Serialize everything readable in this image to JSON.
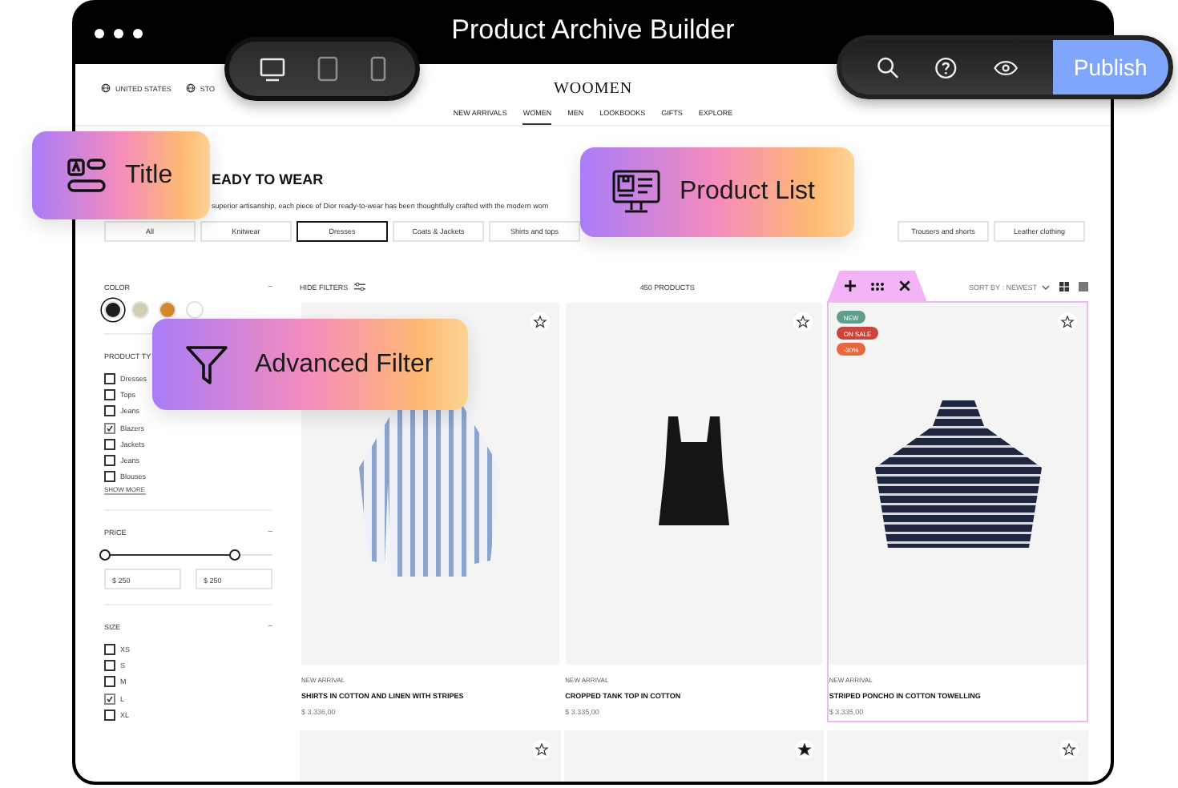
{
  "window": {
    "title": "Product Archive Builder"
  },
  "device_switcher": [
    {
      "kind": "desktop",
      "selected": true
    },
    {
      "kind": "tablet",
      "selected": false
    },
    {
      "kind": "phone",
      "selected": false
    }
  ],
  "toolbar": {
    "publish": "Publish"
  },
  "store": {
    "locale_links": [
      "UNITED STATES",
      "STO"
    ],
    "logo": "WOOMEN",
    "nav": [
      {
        "label": "NEW ARRIVALS",
        "selected": false
      },
      {
        "label": "WOMEN",
        "selected": true
      },
      {
        "label": "MEN",
        "selected": false
      },
      {
        "label": "LOOKBOOKS",
        "selected": false
      },
      {
        "label": "GIFTS",
        "selected": false
      },
      {
        "label": "EXPLORE",
        "selected": false
      }
    ],
    "heading": "EADY TO WEAR",
    "description": "superior artisanship, each piece of Dior ready-to-wear has been thoughtfully crafted with the modern wom",
    "categories": [
      {
        "label": "All",
        "selected": false
      },
      {
        "label": "Knitwear",
        "selected": false
      },
      {
        "label": "Dresses",
        "selected": true
      },
      {
        "label": "Coats & Jackets",
        "selected": false
      },
      {
        "label": "Shirts and tops",
        "selected": false
      },
      {
        "label": "Trousers and shorts",
        "selected": false
      },
      {
        "label": "Leather clothing",
        "selected": false
      }
    ]
  },
  "filters": {
    "color": {
      "title": "COLOR",
      "toggle": "–",
      "swatches": [
        {
          "color": "#1c1c1c",
          "selected": true
        },
        {
          "color": "#d3ceb2",
          "selected": false
        },
        {
          "color": "#d48a2c",
          "selected": false
        },
        {
          "color": "#ffffff",
          "selected": false
        }
      ]
    },
    "product_type": {
      "title": "PRODUCT TY",
      "options": [
        {
          "label": "Dresses",
          "checked": false
        },
        {
          "label": "Tops",
          "checked": false
        },
        {
          "label": "Jeans",
          "checked": false
        },
        {
          "label": "Blazers",
          "checked": true
        },
        {
          "label": "Jackets",
          "checked": false
        },
        {
          "label": "Jeans",
          "checked": false
        },
        {
          "label": "Blouses",
          "checked": false
        }
      ],
      "show_more": "SHOW MORE"
    },
    "price": {
      "title": "PRICE",
      "toggle": "–",
      "range_start": {
        "level": 0
      },
      "range_end": {
        "level": 0.77
      },
      "min": "$ 250",
      "max": "$ 250"
    },
    "size": {
      "title": "SIZE",
      "toggle": "–",
      "options": [
        {
          "label": "XS",
          "checked": false
        },
        {
          "label": "S",
          "checked": false
        },
        {
          "label": "M",
          "checked": false
        },
        {
          "label": "L",
          "checked": true
        },
        {
          "label": "XL",
          "checked": false
        }
      ]
    }
  },
  "products_bar": {
    "hide_filters": "HIDE FILTERS",
    "count": "450 PRODUCTS",
    "sort": "SORT BY : NEWEST"
  },
  "products": [
    {
      "tag": "NEW ARRIVAL",
      "name": "SHIRTS IN COTTON AND LINEN WITH STRIPES",
      "price": "$ 3.336,00",
      "favorite": false,
      "selected": false
    },
    {
      "tag": "NEW ARRIVAL",
      "name": "CROPPED TANK TOP IN COTTON",
      "price": "$ 3.335,00",
      "favorite": false,
      "selected": false
    },
    {
      "tag": "NEW ARRIVAL",
      "name": "STRIPED PONCHO IN COTTON TOWELLING",
      "price": "$ 3.335,00",
      "favorite": false,
      "selected": true,
      "badges": [
        {
          "label": "NEW",
          "color": "#5e9e8c"
        },
        {
          "label": "ON SALE",
          "color": "#c8463c"
        },
        {
          "label": "-30%",
          "color": "#e8673f"
        }
      ]
    }
  ],
  "more_products": [
    {
      "favorite": false
    },
    {
      "favorite": true
    },
    {
      "favorite": false
    }
  ],
  "overlays": [
    {
      "kind": "title",
      "label": "Title"
    },
    {
      "kind": "product_list",
      "label": "Product List"
    },
    {
      "kind": "filter",
      "label": "Advanced Filter"
    }
  ]
}
